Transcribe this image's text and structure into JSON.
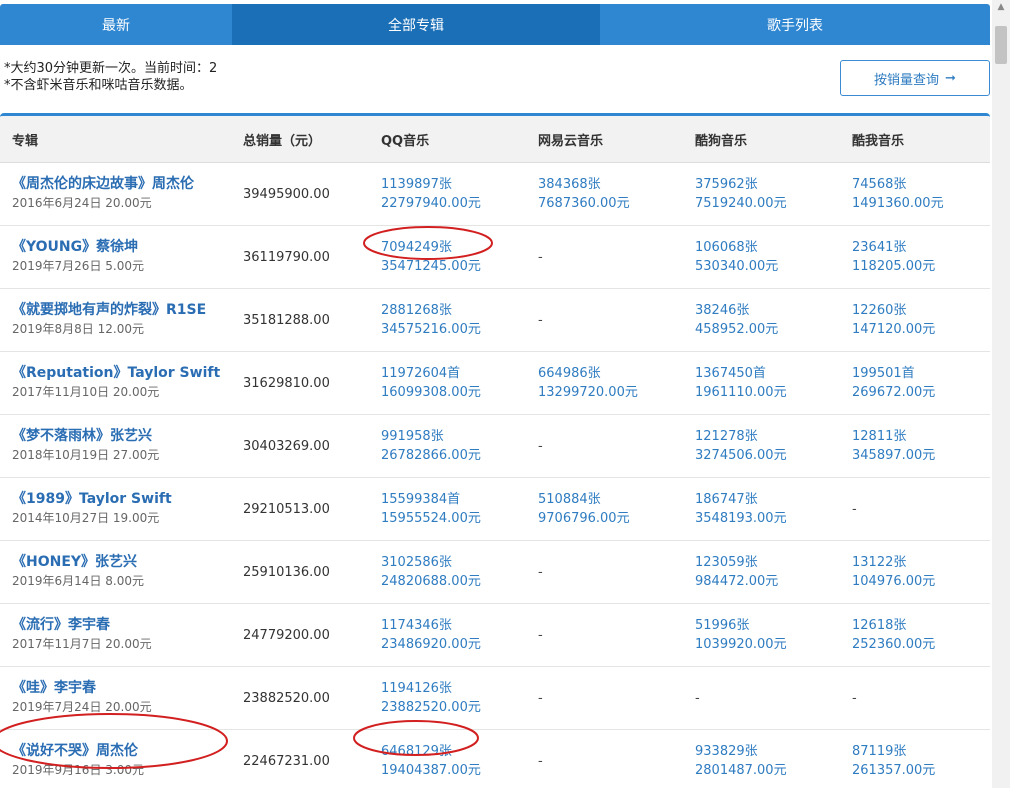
{
  "tabs": [
    {
      "label": "最新"
    },
    {
      "label": "全部专辑"
    },
    {
      "label": "歌手列表"
    }
  ],
  "notice": {
    "line1": "*大约30分钟更新一次。当前时间：2",
    "line2": "*不含虾米音乐和咪咕音乐数据。"
  },
  "query_button": {
    "label": "按销量查询",
    "icon": "arrow-right-icon"
  },
  "table": {
    "headers": [
      "专辑",
      "总销量（元）",
      "QQ音乐",
      "网易云音乐",
      "酷狗音乐",
      "酷我音乐"
    ],
    "rows": [
      {
        "name": "《周杰伦的床边故事》周杰伦",
        "meta": "2016年6月24日 20.00元",
        "total": "39495900.00",
        "qq": [
          "1139897张",
          "22797940.00元"
        ],
        "netease": [
          "384368张",
          "7687360.00元"
        ],
        "kugou": [
          "375962张",
          "7519240.00元"
        ],
        "kuwo": [
          "74568张",
          "1491360.00元"
        ]
      },
      {
        "name": "《YOUNG》蔡徐坤",
        "meta": "2019年7月26日 5.00元",
        "total": "36119790.00",
        "qq": [
          "7094249张",
          "35471245.00元"
        ],
        "netease": [
          "-",
          ""
        ],
        "kugou": [
          "106068张",
          "530340.00元"
        ],
        "kuwo": [
          "23641张",
          "118205.00元"
        ]
      },
      {
        "name": "《就要掷地有声的炸裂》R1SE",
        "meta": "2019年8月8日 12.00元",
        "total": "35181288.00",
        "qq": [
          "2881268张",
          "34575216.00元"
        ],
        "netease": [
          "-",
          ""
        ],
        "kugou": [
          "38246张",
          "458952.00元"
        ],
        "kuwo": [
          "12260张",
          "147120.00元"
        ]
      },
      {
        "name": "《Reputation》Taylor Swift",
        "meta": "2017年11月10日 20.00元",
        "total": "31629810.00",
        "qq": [
          "11972604首",
          "16099308.00元"
        ],
        "netease": [
          "664986张",
          "13299720.00元"
        ],
        "kugou": [
          "1367450首",
          "1961110.00元"
        ],
        "kuwo": [
          "199501首",
          "269672.00元"
        ]
      },
      {
        "name": "《梦不落雨林》张艺兴",
        "meta": "2018年10月19日 27.00元",
        "total": "30403269.00",
        "qq": [
          "991958张",
          "26782866.00元"
        ],
        "netease": [
          "-",
          ""
        ],
        "kugou": [
          "121278张",
          "3274506.00元"
        ],
        "kuwo": [
          "12811张",
          "345897.00元"
        ]
      },
      {
        "name": "《1989》Taylor Swift",
        "meta": "2014年10月27日 19.00元",
        "total": "29210513.00",
        "qq": [
          "15599384首",
          "15955524.00元"
        ],
        "netease": [
          "510884张",
          "9706796.00元"
        ],
        "kugou": [
          "186747张",
          "3548193.00元"
        ],
        "kuwo": [
          "-",
          ""
        ]
      },
      {
        "name": "《HONEY》张艺兴",
        "meta": "2019年6月14日 8.00元",
        "total": "25910136.00",
        "qq": [
          "3102586张",
          "24820688.00元"
        ],
        "netease": [
          "-",
          ""
        ],
        "kugou": [
          "123059张",
          "984472.00元"
        ],
        "kuwo": [
          "13122张",
          "104976.00元"
        ]
      },
      {
        "name": "《流行》李宇春",
        "meta": "2017年11月7日 20.00元",
        "total": "24779200.00",
        "qq": [
          "1174346张",
          "23486920.00元"
        ],
        "netease": [
          "-",
          ""
        ],
        "kugou": [
          "51996张",
          "1039920.00元"
        ],
        "kuwo": [
          "12618张",
          "252360.00元"
        ]
      },
      {
        "name": "《哇》李宇春",
        "meta": "2019年7月24日 20.00元",
        "total": "23882520.00",
        "qq": [
          "1194126张",
          "23882520.00元"
        ],
        "netease": [
          "-",
          ""
        ],
        "kugou": [
          "-",
          ""
        ],
        "kuwo": [
          "-",
          ""
        ]
      },
      {
        "name": "《说好不哭》周杰伦",
        "meta": "2019年9月16日 3.00元",
        "total": "22467231.00",
        "qq": [
          "6468129张",
          "19404387.00元"
        ],
        "netease": [
          "-",
          ""
        ],
        "kugou": [
          "933829张",
          "2801487.00元"
        ],
        "kuwo": [
          "87119张",
          "261357.00元"
        ]
      }
    ]
  },
  "annotation_color": "#d21f1f"
}
